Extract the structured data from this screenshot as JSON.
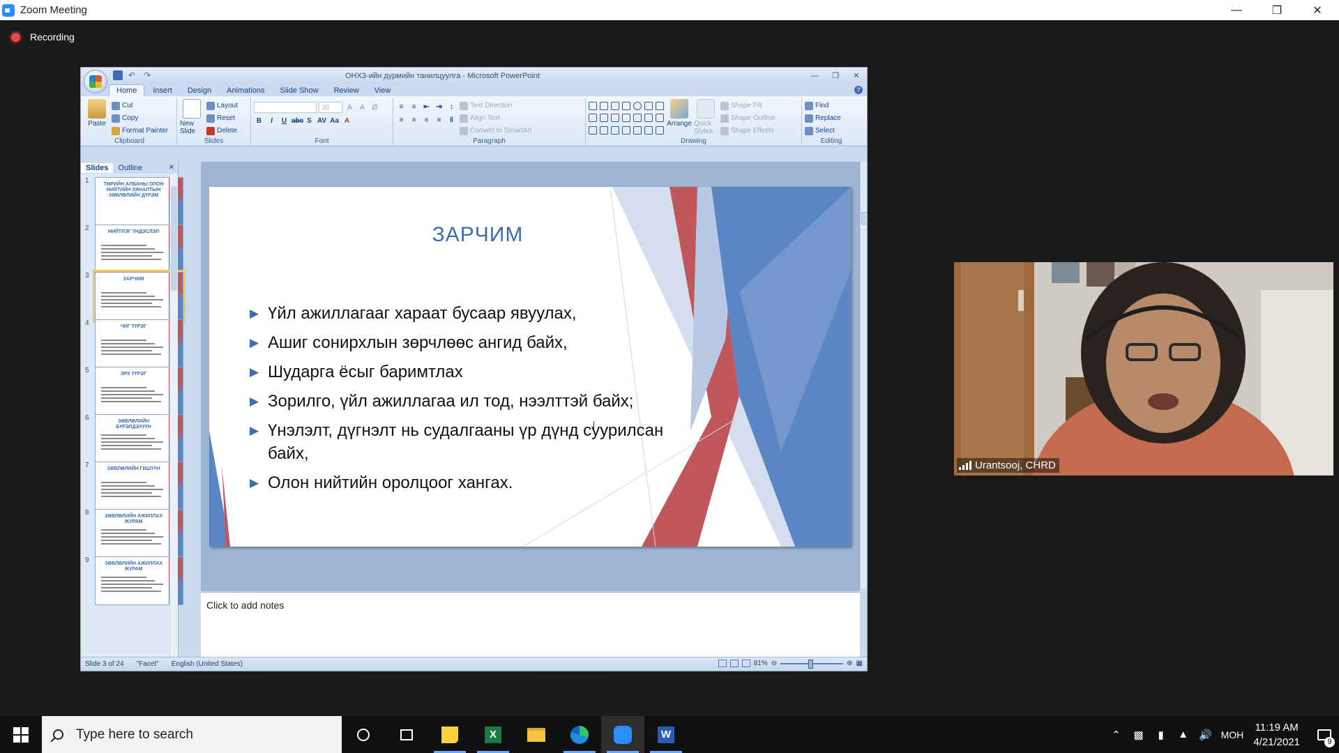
{
  "zoom": {
    "window_title": "Zoom Meeting",
    "recording_label": "Recording"
  },
  "ppt": {
    "title": "ОНХЗ-ийн дүрмийн танилцуулга - Microsoft PowerPoint",
    "tabs": [
      "Home",
      "Insert",
      "Design",
      "Animations",
      "Slide Show",
      "Review",
      "View"
    ],
    "active_tab": "Home",
    "ribbon": {
      "clipboard": {
        "label": "Clipboard",
        "paste": "Paste",
        "cut": "Cut",
        "copy": "Copy",
        "format_painter": "Format Painter"
      },
      "slides": {
        "label": "Slides",
        "new_slide": "New Slide",
        "layout": "Layout",
        "reset": "Reset",
        "delete": "Delete"
      },
      "font": {
        "label": "Font",
        "size": "20"
      },
      "paragraph": {
        "label": "Paragraph",
        "text_direction": "Text Direction",
        "align_text": "Align Text",
        "convert_smartart": "Convert to SmartArt"
      },
      "drawing": {
        "label": "Drawing",
        "arrange": "Arrange",
        "quick_styles": "Quick Styles",
        "shape_fill": "Shape Fill",
        "shape_outline": "Shape Outline",
        "shape_effects": "Shape Effects"
      },
      "editing": {
        "label": "Editing",
        "find": "Find",
        "replace": "Replace",
        "select": "Select"
      }
    },
    "panel_tabs": {
      "slides": "Slides",
      "outline": "Outline"
    },
    "thumbnails": [
      {
        "num": "1",
        "title": "ТӨРИЙН АЛБАНЫ ОЛОН НИЙТИЙН ХЯНАЛТЫН ЗӨВЛӨЛИЙН ДҮРЭМ"
      },
      {
        "num": "2",
        "title": "НИЙТЛЭГ ҮНДЭСЛЭЛ"
      },
      {
        "num": "3",
        "title": "ЗАРЧИМ"
      },
      {
        "num": "4",
        "title": "ЧИГ ҮҮРЭГ"
      },
      {
        "num": "5",
        "title": "ЭРХ ҮҮРЭГ"
      },
      {
        "num": "6",
        "title": "ЗӨВЛӨЛИЙН БҮРЭЛДЭХҮҮН"
      },
      {
        "num": "7",
        "title": "ЗӨВЛӨЛИЙН ГИШҮҮН"
      },
      {
        "num": "8",
        "title": "ЗӨВЛӨЛИЙН АЖИЛЛАХ ЖУРАМ"
      },
      {
        "num": "9",
        "title": "ЗӨВЛӨЛИЙН АЖИЛЛАХ ЖУРАМ"
      }
    ],
    "selected_slide": "3",
    "slide": {
      "title": "ЗАРЧИМ",
      "bullets": [
        " Үйл ажиллагааг хараат бусаар явуулах,",
        "Ашиг сонирхлын зөрчлөөс ангид байх,",
        "Шударга ёсыг баримтлах",
        "Зорилго, үйл ажиллагаа ил тод, нээлттэй байх;",
        "Үнэлэлт, дүгнэлт нь судалгааны үр дүнд суурилсан байх,",
        "Олон нийтийн оролцоог хангах."
      ]
    },
    "notes_placeholder": "Click to add notes",
    "status": {
      "slide_of": "Slide 3 of 24",
      "theme": "\"Facet\"",
      "language": "English (United States)",
      "zoom": "81%"
    }
  },
  "participant": {
    "name": "Urantsooj, CHRD"
  },
  "taskbar": {
    "search_placeholder": "Type here to search",
    "input_lang": "МОН",
    "time": "11:19 AM",
    "date": "4/21/2021",
    "notification_count": "9"
  },
  "colors": {
    "accent": "#3d6db0",
    "slide_red": "#c0575c",
    "slide_blue": "#5b86c5",
    "recording_red": "#e5484d"
  }
}
